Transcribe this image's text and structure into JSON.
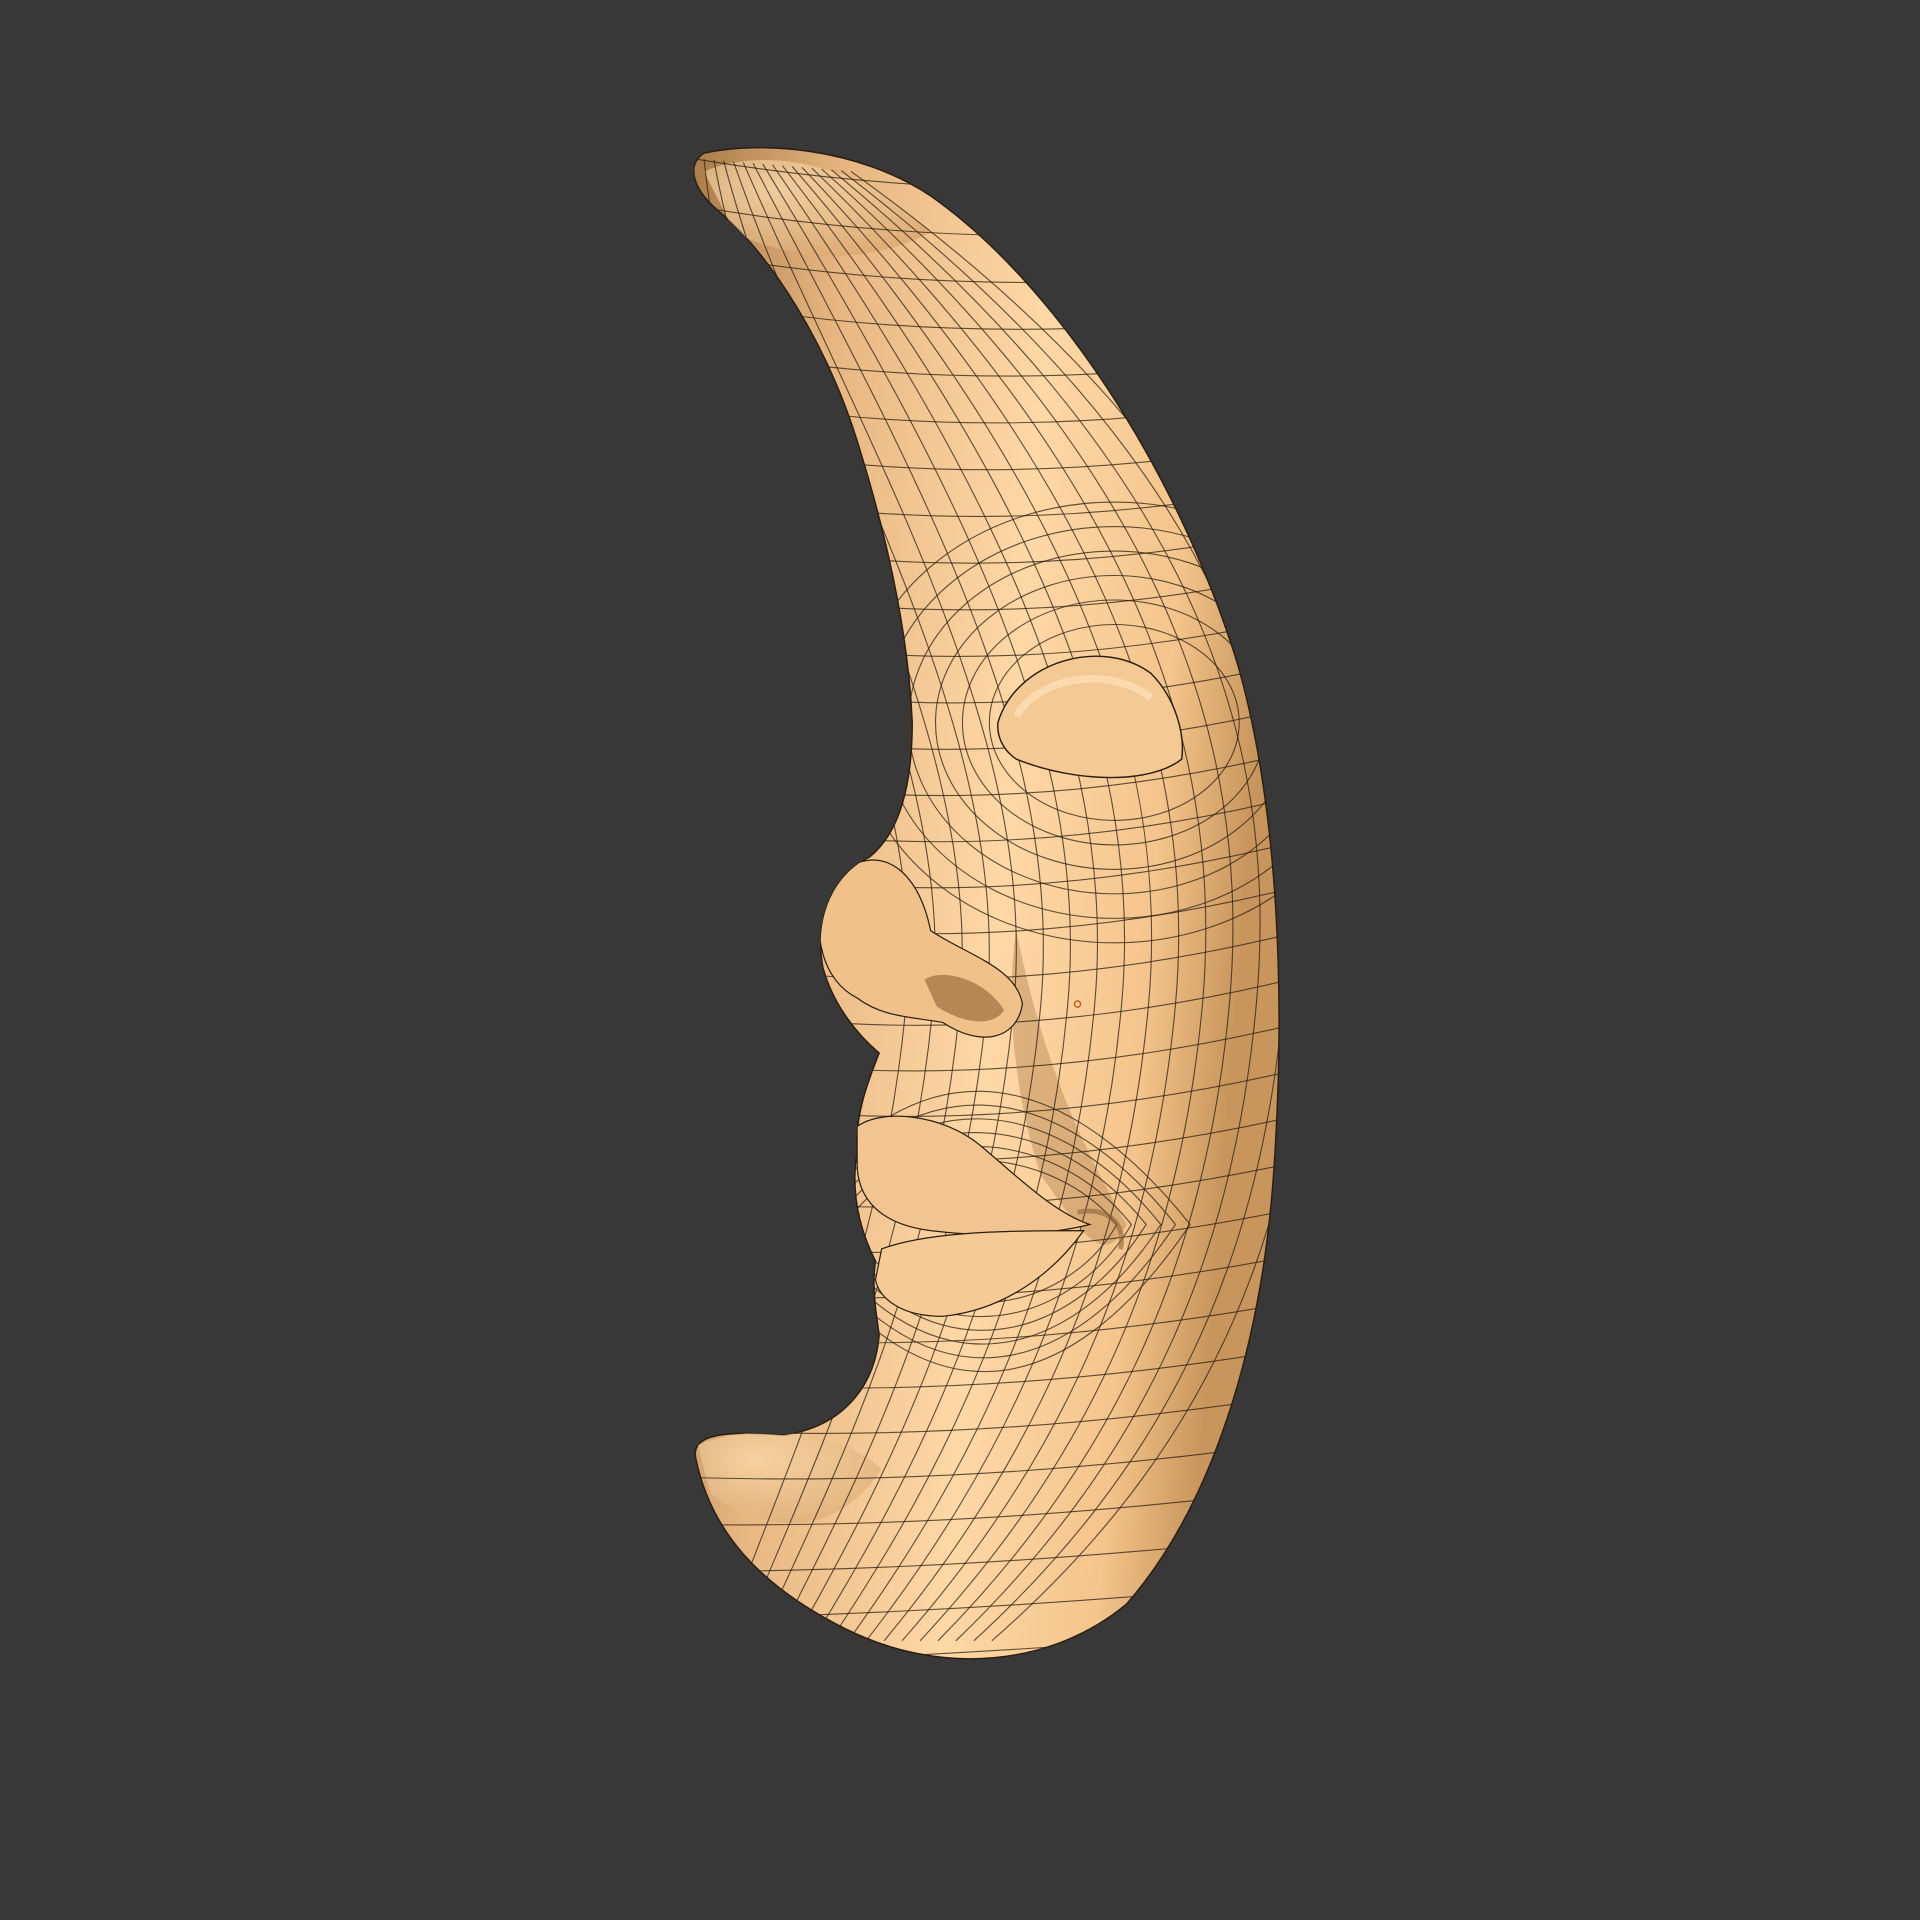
{
  "viewport": {
    "background": "#383838",
    "model": {
      "name": "crescent-moon-face",
      "base_color": "#f2c58e",
      "shadow_color": "#b98a56",
      "highlight_color": "#ffe0b4",
      "wire_color": "#2a1e12",
      "marker_color": "#c0602a"
    }
  }
}
